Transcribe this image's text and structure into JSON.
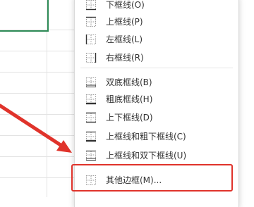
{
  "menu": {
    "items": [
      {
        "label": "下框线(O)",
        "icon": "bottom-border-icon"
      },
      {
        "label": "上框线(P)",
        "icon": "top-border-icon"
      },
      {
        "label": "左框线(L)",
        "icon": "left-border-icon"
      },
      {
        "label": "右框线(R)",
        "icon": "right-border-icon"
      },
      {
        "label": "双底框线(B)",
        "icon": "double-bottom-border-icon"
      },
      {
        "label": "粗底框线(H)",
        "icon": "thick-bottom-border-icon"
      },
      {
        "label": "上下框线(D)",
        "icon": "top-bottom-border-icon"
      },
      {
        "label": "上框线和粗下框线(C)",
        "icon": "top-thick-bottom-border-icon"
      },
      {
        "label": "上框线和双下框线(U)",
        "icon": "top-double-bottom-border-icon"
      },
      {
        "label": "其他边框(M)...",
        "icon": "more-borders-icon"
      }
    ]
  },
  "colors": {
    "annotation": "#e0332b",
    "selection": "#2e8b57"
  }
}
